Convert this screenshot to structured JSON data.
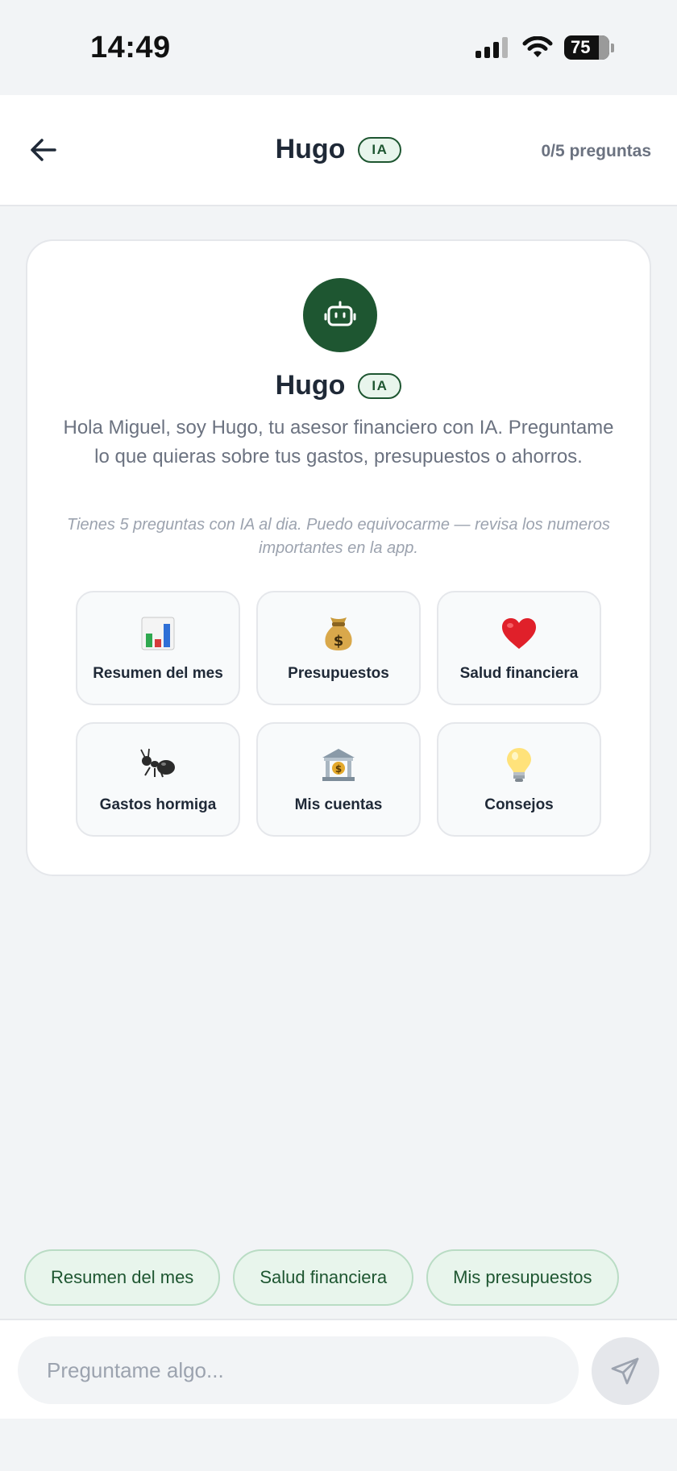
{
  "status_bar": {
    "time": "14:49",
    "battery": "75"
  },
  "header": {
    "title": "Hugo",
    "badge": "IA",
    "questions_count": "0/5 preguntas"
  },
  "welcome": {
    "title": "Hugo",
    "badge": "IA",
    "intro": "Hola Miguel, soy Hugo, tu asesor financiero con IA. Preguntame lo que quieras sobre tus gastos, presupuestos o ahorros.",
    "disclaimer": "Tienes 5 preguntas con IA al dia. Puedo equivocarme — revisa los numeros importantes en la app."
  },
  "topics": [
    {
      "label": "Resumen del mes",
      "icon": "bar-chart-icon"
    },
    {
      "label": "Presupuestos",
      "icon": "money-bag-icon"
    },
    {
      "label": "Salud financiera",
      "icon": "heart-icon"
    },
    {
      "label": "Gastos hormiga",
      "icon": "ant-icon"
    },
    {
      "label": "Mis cuentas",
      "icon": "bank-icon"
    },
    {
      "label": "Consejos",
      "icon": "lightbulb-icon"
    }
  ],
  "chips": [
    "Resumen del mes",
    "Salud financiera",
    "Mis presupuestos"
  ],
  "input": {
    "placeholder": "Preguntame algo..."
  },
  "colors": {
    "brand": "#1e5631",
    "chip_bg": "#e8f5ec",
    "page_bg": "#f2f4f6"
  }
}
